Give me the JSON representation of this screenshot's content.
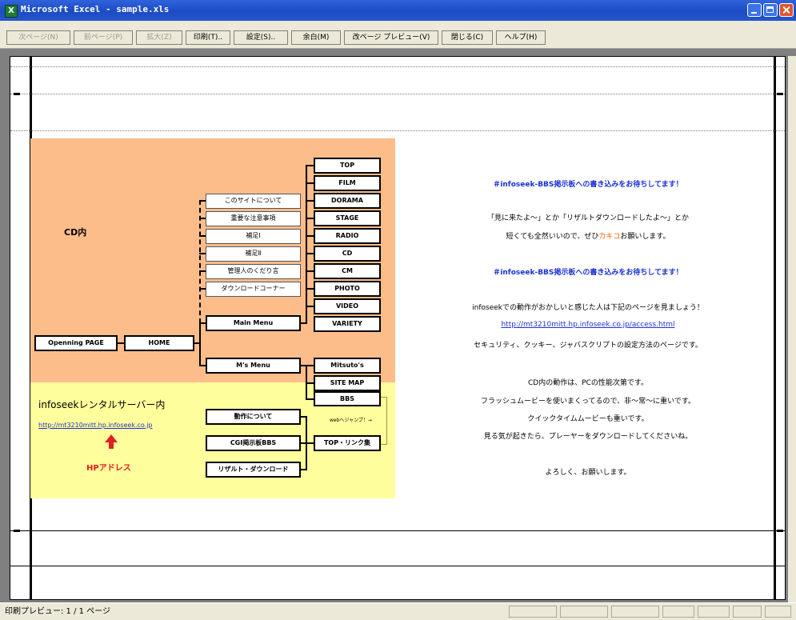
{
  "window": {
    "title": "Microsoft Excel - sample.xls"
  },
  "toolbar": {
    "buttons": [
      {
        "label": "次ページ(N)",
        "enabled": false
      },
      {
        "label": "前ページ(P)",
        "enabled": false
      },
      {
        "label": "拡大(Z)",
        "enabled": false
      },
      {
        "label": "印刷(T)..",
        "enabled": true
      },
      {
        "label": "設定(S)..",
        "enabled": true
      },
      {
        "label": "余白(M)",
        "enabled": true
      },
      {
        "label": "改ページ プレビュー(V)",
        "enabled": true
      },
      {
        "label": "閉じる(C)",
        "enabled": true
      },
      {
        "label": "ヘルプ(H)",
        "enabled": true
      }
    ]
  },
  "sheet": {
    "cd_label": "CD内",
    "infoseek_label": "infoseekレンタルサーバー内",
    "url": "http://mt3210mitt.hp.infoseek.co.jp",
    "hp_address": "HPアドレス",
    "boxes": {
      "opening": "Openning PAGE",
      "home": "HOME",
      "about": "このサイトについて",
      "notice": "重要な注意事項",
      "supp1": "補足Ⅰ",
      "supp2": "補足Ⅱ",
      "admin": "管理人のくだり言",
      "download": "ダウンロードコーナー",
      "main_menu": "Main Menu",
      "top": "TOP",
      "film": "FILM",
      "dorama": "DORAMA",
      "stage": "STAGE",
      "radio": "RADIO",
      "cd": "CD",
      "cm": "CM",
      "photo": "PHOTO",
      "video": "VIDEO",
      "variety": "VARIETY",
      "ms_menu": "M's Menu",
      "mitsuto": "Mitsuto's",
      "sitemap": "SITE MAP",
      "bbs": "BBS",
      "dousa": "動作について",
      "cgi_bbs": "CGI掲示板BBS",
      "result_dl": "リザルト・ダウンロード",
      "top_links": "TOP・リンク集",
      "web_jump": "webへジャンプ！→"
    },
    "right_text": {
      "line1": "＃infoseek-BBS掲示板への書き込みをお待ちしてます！",
      "line2": "「見に来たよ～」とか「リザルトダウンロードしたよ～」とか",
      "line3a": "短くても全然いいので、ぜひ",
      "line3b": "カキコ",
      "line3c": "お願いします。",
      "line4": "＃infoseek-BBS掲示板への書き込みをお待ちしてます！",
      "line5": "infoseekでの動作がおかしいと感じた人は下記のページを見ましょう！",
      "line6": "http://mt3210mitt.hp.infoseek.co.jp/access.html",
      "line7": "セキュリティ、クッキー、ジャバスクリプトの設定方法のページです。",
      "line8": "CD内の動作は、PCの性能次第です。",
      "line9": "フラッシュムービーを使いまくってるので、非～常～に重いです。",
      "line10": "クイックタイムムービーも重いです。",
      "line11": "見る気が起きたら、プレーヤーをダウンロードしてくださいね。",
      "line12": "よろしく、お願いします。"
    }
  },
  "status": {
    "text": "印刷プレビュー: 1 / 1 ページ"
  },
  "colors": {
    "orange": "#fdbd8b",
    "yellow": "#fefe9c",
    "blue": "#1a30d6",
    "red": "#e02020",
    "orange_text": "#ff6600"
  }
}
